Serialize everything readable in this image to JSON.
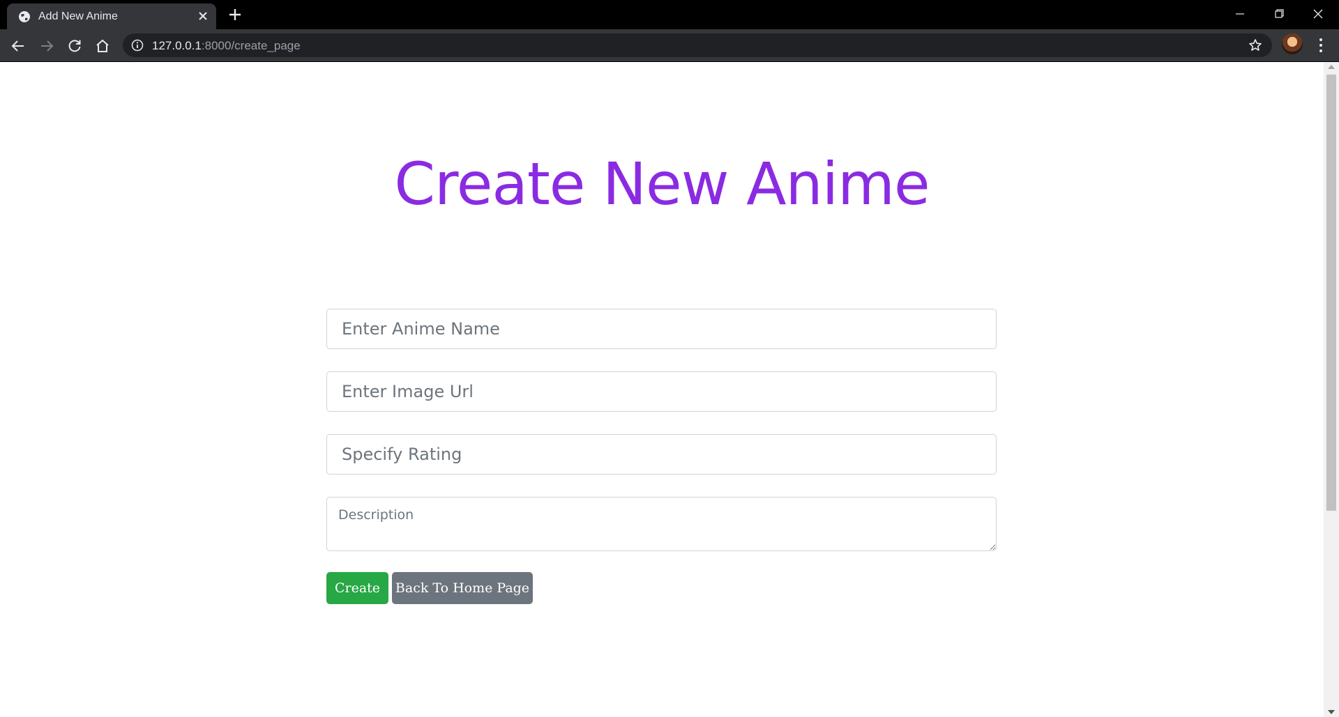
{
  "browser": {
    "tab_title": "Add New Anime",
    "url_host": "127.0.0.1",
    "url_path": ":8000/create_page"
  },
  "page": {
    "title": "Create New Anime",
    "form": {
      "name_placeholder": "Enter Anime Name",
      "image_placeholder": "Enter Image Url",
      "rating_placeholder": "Specify Rating",
      "description_placeholder": "Description",
      "create_label": "Create",
      "back_label": "Back To Home Page"
    }
  },
  "colors": {
    "title": "#8a2be2",
    "create_button": "#28a745",
    "back_button": "#6c757d"
  }
}
